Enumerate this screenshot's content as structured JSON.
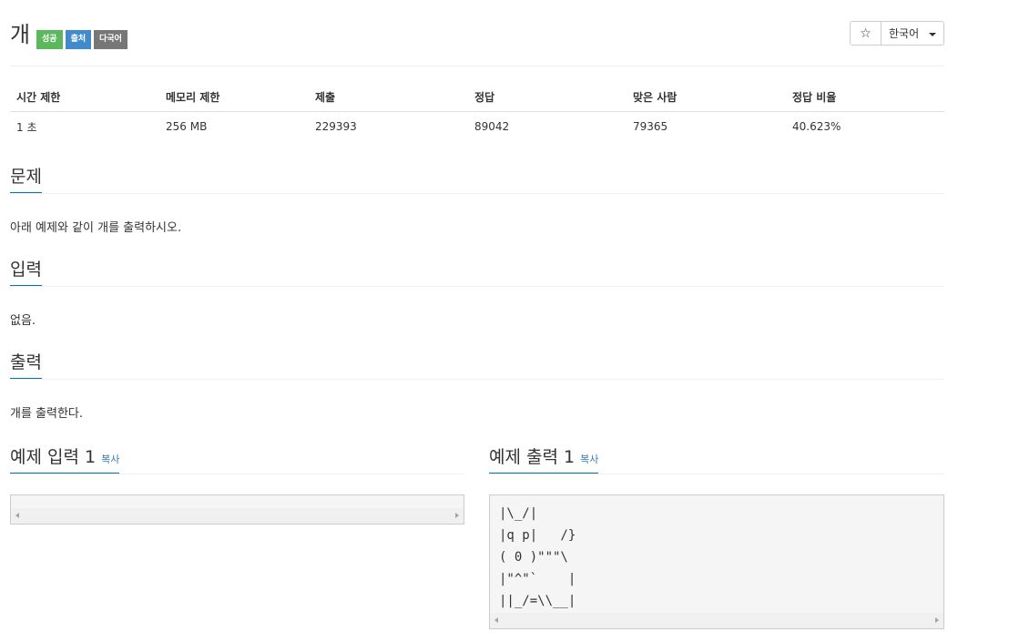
{
  "problem": {
    "title": "개",
    "badges": [
      {
        "label": "성공",
        "color": "#5cb85c"
      },
      {
        "label": "출처",
        "color": "#428bca"
      },
      {
        "label": "다국어",
        "color": "#777777"
      }
    ]
  },
  "toolbar": {
    "star_icon": "☆",
    "language": "한국어"
  },
  "stats": {
    "headers": [
      "시간 제한",
      "메모리 제한",
      "제출",
      "정답",
      "맞은 사람",
      "정답 비율"
    ],
    "values": [
      "1 초",
      "256 MB",
      "229393",
      "89042",
      "79365",
      "40.623%"
    ]
  },
  "sections": {
    "problem": {
      "title": "문제",
      "text": "아래 예제와 같이 개를 출력하시오."
    },
    "input": {
      "title": "입력",
      "text": "없음."
    },
    "output": {
      "title": "출력",
      "text": "개를 출력한다."
    }
  },
  "samples": {
    "copy_label": "복사",
    "input": {
      "title": "예제 입력 1",
      "lines": []
    },
    "output": {
      "title": "예제 출력 1",
      "lines": [
        "|\\_/|",
        "|q p|   /}",
        "( 0 )\"\"\"\\",
        "|\"^\"`    |",
        "||_/=\\\\__|"
      ]
    }
  }
}
